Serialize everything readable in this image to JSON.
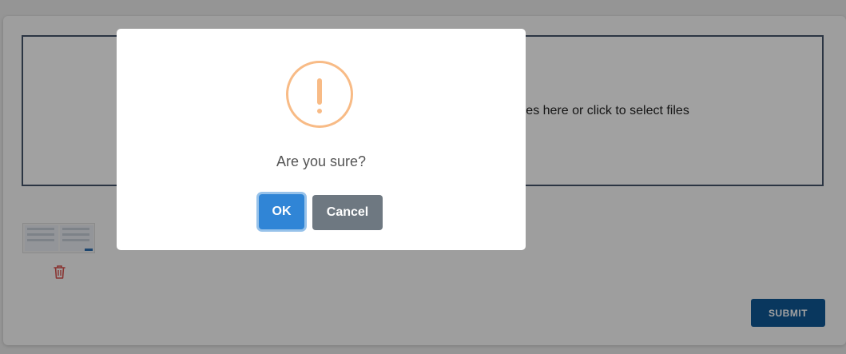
{
  "upload": {
    "dropzone_text": "Drag and drop files here or click to select files",
    "submit_label": "SUBMIT"
  },
  "dialog": {
    "icon": "warning-icon",
    "title": "Are you sure?",
    "ok_label": "OK",
    "cancel_label": "Cancel"
  },
  "colors": {
    "warning": "#f8bb86",
    "ok_button": "#3085d6",
    "cancel_button": "#6e7881",
    "submit_button": "#0f5796",
    "delete_icon": "#d9534f"
  }
}
